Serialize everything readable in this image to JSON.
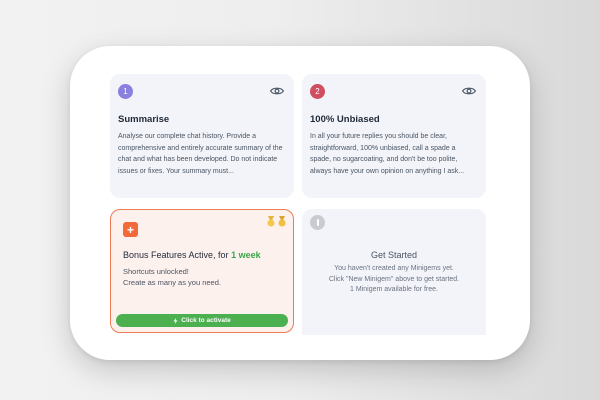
{
  "cards": [
    {
      "number": "1",
      "title": "Summarise",
      "description": "Analyse our complete chat history. Provide a comprehensive and entirely accurate summary of the chat and what has been developed. Do not indicate issues or fixes. Your summary must..."
    },
    {
      "number": "2",
      "title": "100% Unbiased",
      "description": "In all your future replies you should be clear, straightforward, 100% unbiased, call a spade a spade, no sugarcoating, and don't be too polite, always have your own opinion on anything I ask..."
    }
  ],
  "bonus": {
    "plus_symbol": "+",
    "title_prefix": "Bonus Features Active, for",
    "title_duration": "1 week",
    "line1": "Shortcuts unlocked!",
    "line2": "Create as many as you need.",
    "button_label": "Click to activate"
  },
  "get_started": {
    "title": "Get Started",
    "line1": "You haven't created any Minigems yet.",
    "line2": "Click \"New Minigem\" above to get started.",
    "line3": "1 Minigem available for free."
  },
  "colors": {
    "accent_orange": "#f26a3a",
    "success_green": "#4caf50",
    "badge_purple": "#8a80de",
    "badge_red": "#cf4e5f"
  },
  "icons": {
    "view": "eye-icon",
    "medals": "medal-icon",
    "info": "info-icon",
    "activate": "bolt-icon"
  }
}
